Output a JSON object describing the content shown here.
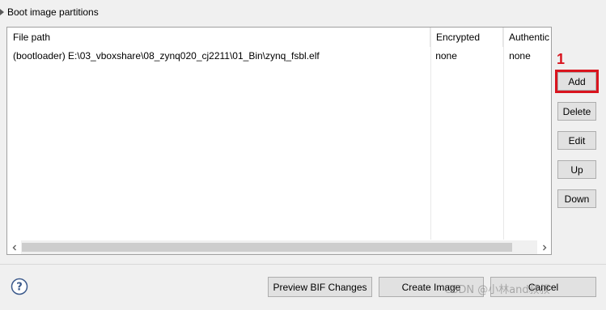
{
  "group": {
    "title": "Boot image partitions"
  },
  "table": {
    "columns": [
      "File path",
      "Encrypted",
      "Authentic"
    ],
    "rows": [
      {
        "path": "(bootloader) E:\\03_vboxshare\\08_zynq020_cj2211\\01_Bin\\zynq_fsbl.elf",
        "encrypted": "none",
        "authentication": "none"
      }
    ]
  },
  "side_buttons": {
    "add": "Add",
    "delete": "Delete",
    "edit": "Edit",
    "up": "Up",
    "down": "Down"
  },
  "annotation": {
    "step_number": "1",
    "color": "#d9141e"
  },
  "bottom_buttons": {
    "preview": "Preview BIF Changes",
    "create": "Create Image",
    "cancel": "Cancel"
  },
  "watermark": "CSDN @小林and叔叔",
  "icons": {
    "help": "help-icon",
    "expand": "expand-triangle-icon",
    "scroll_left": "scroll-left-arrow-icon",
    "scroll_right": "scroll-right-arrow-icon"
  }
}
